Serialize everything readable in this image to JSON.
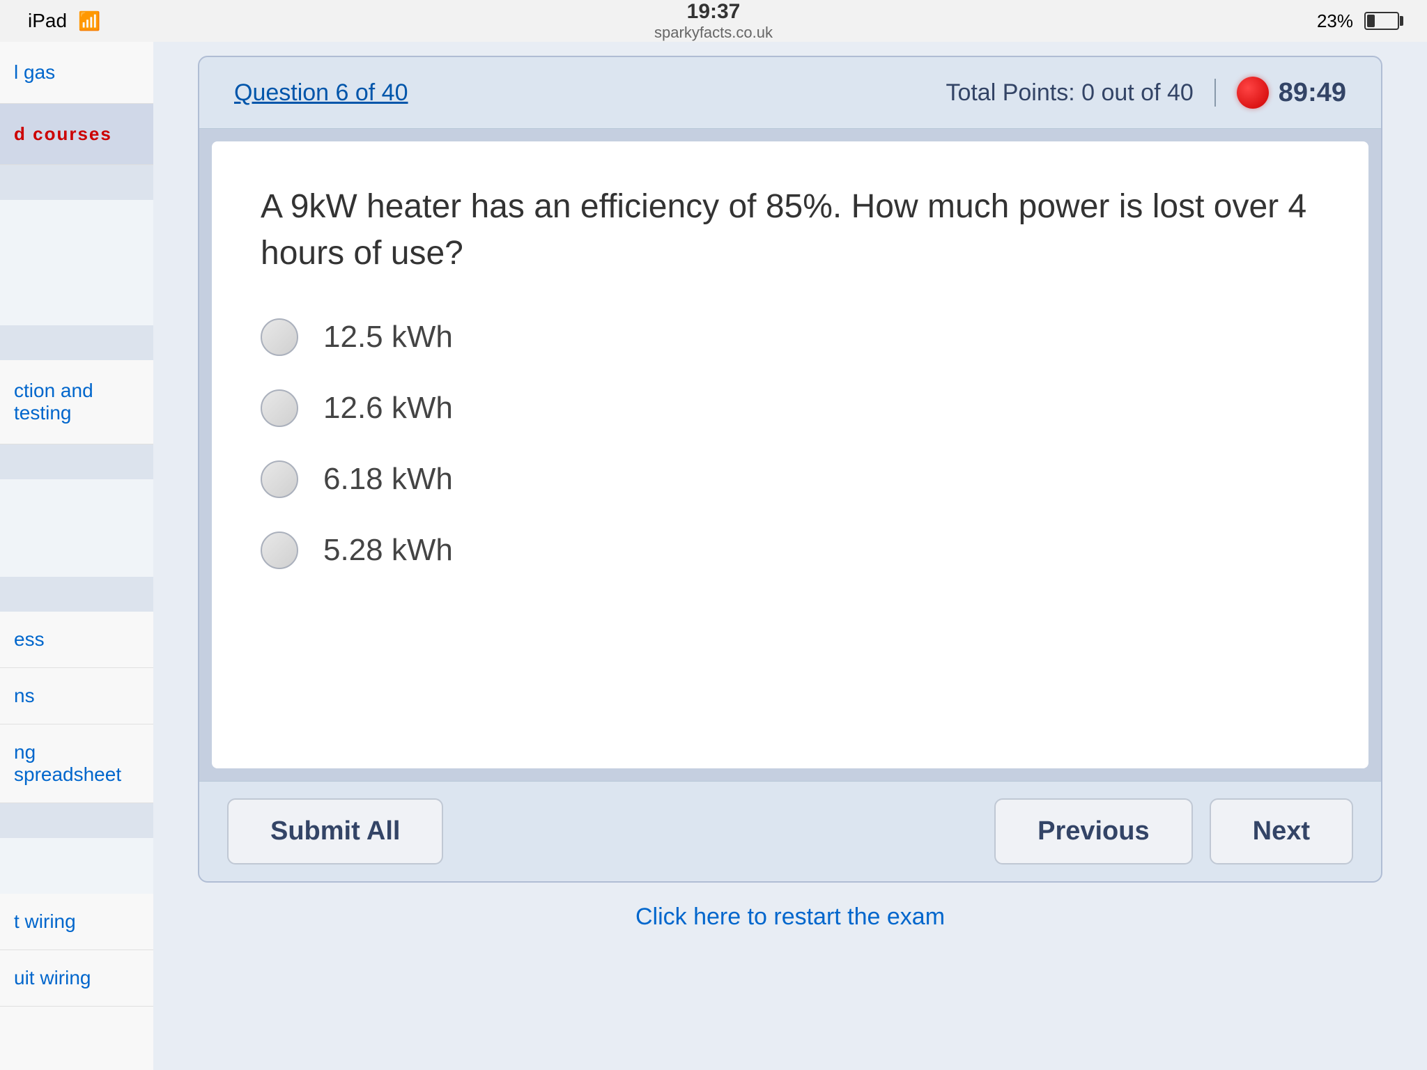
{
  "statusBar": {
    "leftLabel": "iPad",
    "wifiLabel": "wifi",
    "time": "19:37",
    "siteLabel": "sparkyfacts.co.uk",
    "batteryPercent": "23%"
  },
  "sidebar": {
    "items": [
      {
        "label": "l gas",
        "style": "normal"
      },
      {
        "label": "d courses",
        "style": "highlighted"
      },
      {
        "divider": true
      },
      {
        "label": "",
        "style": "spacer"
      },
      {
        "divider": true
      },
      {
        "label": "ction and testing",
        "style": "normal"
      },
      {
        "divider": true
      },
      {
        "label": "",
        "style": "spacer"
      },
      {
        "divider": true
      },
      {
        "label": "ess",
        "style": "normal"
      },
      {
        "label": "ns",
        "style": "normal"
      },
      {
        "label": "ng spreadsheet",
        "style": "normal"
      },
      {
        "divider": true
      },
      {
        "label": "",
        "style": "spacer"
      },
      {
        "label": "t wiring",
        "style": "normal"
      },
      {
        "label": "uit wiring",
        "style": "normal"
      }
    ]
  },
  "quiz": {
    "questionCounter": "Question 6 of 40",
    "totalPoints": "Total Points: 0 out of 40",
    "timer": "89:49",
    "questionText": "A 9kW heater has an efficiency of 85%. How much power is lost over 4 hours of use?",
    "answers": [
      {
        "id": "a1",
        "label": "12.5 kWh"
      },
      {
        "id": "a2",
        "label": "12.6 kWh"
      },
      {
        "id": "a3",
        "label": "6.18 kWh"
      },
      {
        "id": "a4",
        "label": "5.28 kWh"
      }
    ],
    "submitAllLabel": "Submit All",
    "previousLabel": "Previous",
    "nextLabel": "Next",
    "restartLabel": "Click here to restart the exam"
  }
}
